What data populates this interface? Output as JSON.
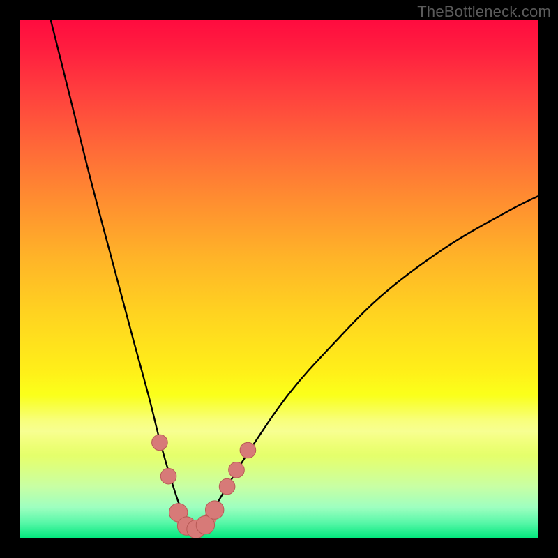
{
  "watermark": {
    "text": "TheBottleneck.com"
  },
  "colors": {
    "frame": "#000000",
    "curve": "#000000",
    "marker_fill": "#d77a78",
    "marker_stroke": "#b85a56"
  },
  "chart_data": {
    "type": "line",
    "title": "",
    "xlabel": "",
    "ylabel": "",
    "xlim": [
      0,
      100
    ],
    "ylim": [
      0,
      100
    ],
    "grid": false,
    "legend": false,
    "note": "Values are percentages estimated from pixel positions; y=0 at bottom edge (green) and y=100 at top edge (red). Curve is a V-shaped bottleneck profile with minimum near x≈33.",
    "series": [
      {
        "name": "bottleneck-curve",
        "x": [
          6,
          10,
          14,
          18,
          22,
          25,
          27,
          29,
          31,
          33,
          35,
          37,
          40,
          45,
          52,
          60,
          70,
          82,
          94,
          100
        ],
        "y": [
          100,
          84,
          68,
          53,
          38,
          27,
          19,
          12,
          6,
          2,
          2,
          5,
          10,
          18,
          28,
          37,
          47,
          56,
          63,
          66
        ]
      }
    ],
    "markers": [
      {
        "name": "left-upper",
        "x": 27.0,
        "y": 18.5,
        "r": 1.7
      },
      {
        "name": "left-lower",
        "x": 28.7,
        "y": 12.0,
        "r": 1.7
      },
      {
        "name": "trough-1",
        "x": 30.6,
        "y": 5.0,
        "r": 2.2
      },
      {
        "name": "trough-2",
        "x": 32.2,
        "y": 2.4,
        "r": 2.2
      },
      {
        "name": "trough-3",
        "x": 34.0,
        "y": 1.8,
        "r": 2.2
      },
      {
        "name": "trough-4",
        "x": 35.8,
        "y": 2.6,
        "r": 2.2
      },
      {
        "name": "trough-5",
        "x": 37.6,
        "y": 5.5,
        "r": 2.2
      },
      {
        "name": "right-1",
        "x": 40.0,
        "y": 10.0,
        "r": 1.7
      },
      {
        "name": "right-2",
        "x": 41.8,
        "y": 13.2,
        "r": 1.7
      },
      {
        "name": "right-3",
        "x": 44.0,
        "y": 17.0,
        "r": 1.7
      }
    ],
    "gradient_stops": [
      {
        "pos": 0,
        "color": "#ff0b3f"
      },
      {
        "pos": 25,
        "color": "#ff6a38"
      },
      {
        "pos": 57,
        "color": "#ffd420"
      },
      {
        "pos": 80,
        "color": "#edff49"
      },
      {
        "pos": 100,
        "color": "#00e77c"
      }
    ]
  }
}
